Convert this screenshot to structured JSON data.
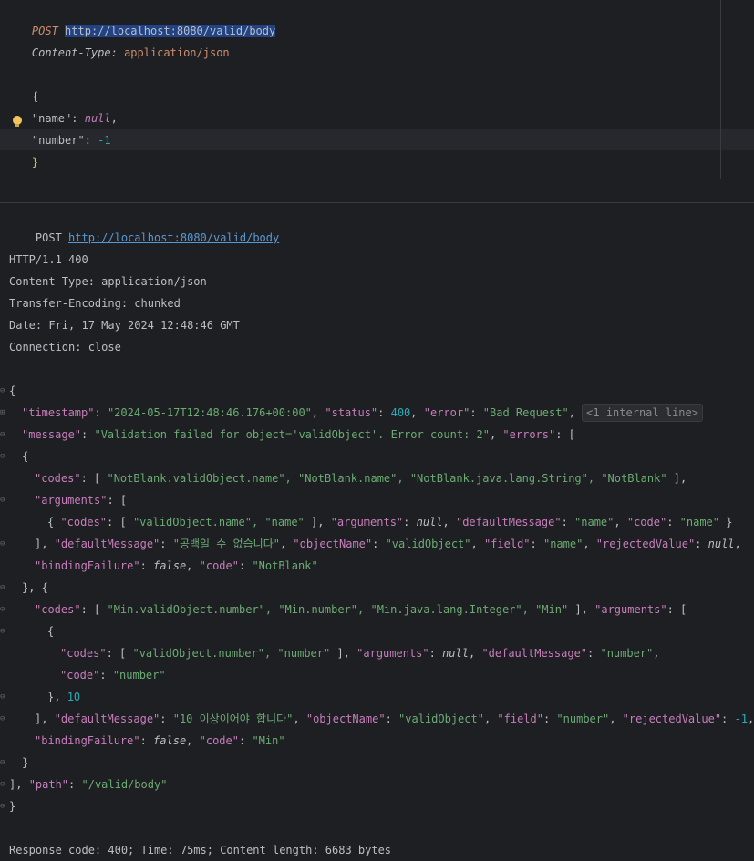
{
  "request": {
    "method": "POST",
    "url": "http://localhost:8080/valid/body",
    "header_name": "Content-Type:",
    "header_value": "application/json",
    "body": {
      "open": "{",
      "name_key": "\"name\"",
      "name_value": "null",
      "number_key": "\"number\"",
      "number_value": "-1",
      "close": "}"
    }
  },
  "response": {
    "method": "POST",
    "url": "http://localhost:8080/valid/body",
    "status_line": "HTTP/1.1 400",
    "headers": [
      "Content-Type: application/json",
      "Transfer-Encoding: chunked",
      "Date: Fri, 17 May 2024 12:48:46 GMT",
      "Connection: close"
    ],
    "fold_hint": "<1 internal line>",
    "footer": "Response code: 400; Time: 75ms; Content length: 6683 bytes",
    "body": {
      "timestamp": "\"2024-05-17T12:48:46.176+00:00\"",
      "status": "400",
      "error": "\"Bad Request\"",
      "message": "\"Validation failed for object='validObject'. Error count: 2\"",
      "e1_codes": "\"NotBlank.validObject.name\", \"NotBlank.name\", \"NotBlank.java.lang.String\", \"NotBlank\"",
      "e1_arg_codes": "\"validObject.name\", \"name\"",
      "e1_arg_default": "\"name\"",
      "e1_arg_code": "\"name\"",
      "e1_default": "\"공백일 수 없습니다\"",
      "e1_object": "\"validObject\"",
      "e1_field": "\"name\"",
      "e1_binding": "false",
      "e1_code": "\"NotBlank\"",
      "e2_codes": "\"Min.validObject.number\", \"Min.number\", \"Min.java.lang.Integer\", \"Min\"",
      "e2_arg_codes": "\"validObject.number\", \"number\"",
      "e2_arg_default": "\"number\"",
      "e2_arg_code": "\"number\"",
      "e2_arg_extra": "10",
      "e2_default": "\"10 이상이어야 합니다\"",
      "e2_object": "\"validObject\"",
      "e2_field": "\"number\"",
      "e2_rejected": "-1",
      "e2_binding": "false",
      "e2_code": "\"Min\"",
      "path": "\"/valid/body\"",
      "null_literal": "null"
    }
  }
}
